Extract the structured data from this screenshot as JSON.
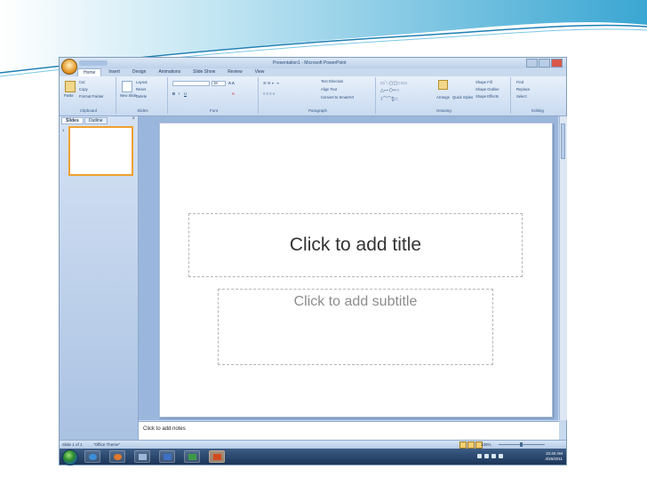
{
  "window": {
    "title": "Presentation1 - Microsoft PowerPoint"
  },
  "ribbon_tabs": [
    "Home",
    "Insert",
    "Design",
    "Animations",
    "Slide Show",
    "Review",
    "View"
  ],
  "ribbon": {
    "clipboard": {
      "label": "Clipboard",
      "paste": "Paste",
      "cut": "Cut",
      "copy": "Copy",
      "format_painter": "Format Painter"
    },
    "slides": {
      "label": "Slides",
      "new_slide": "New Slide",
      "layout": "Layout",
      "reset": "Reset",
      "delete": "Delete"
    },
    "font": {
      "label": "Font",
      "size": "18"
    },
    "paragraph": {
      "label": "Paragraph",
      "text_direction": "Text Direction",
      "align_text": "Align Text",
      "smartart": "Convert to SmartArt"
    },
    "drawing": {
      "label": "Drawing",
      "arrange": "Arrange",
      "quick_styles": "Quick Styles",
      "shape_fill": "Shape Fill",
      "shape_outline": "Shape Outline",
      "shape_effects": "Shape Effects"
    },
    "editing": {
      "label": "Editing",
      "find": "Find",
      "replace": "Replace",
      "select": "Select"
    }
  },
  "panel": {
    "tabs": [
      "Slides",
      "Outline"
    ],
    "thumb_number": "1"
  },
  "slide": {
    "title_placeholder": "Click to add title",
    "subtitle_placeholder": "Click to add subtitle"
  },
  "notes": {
    "placeholder": "Click to add notes"
  },
  "status": {
    "slide": "Slide 1 of 1",
    "theme": "\"Office Theme\"",
    "zoom": "100%"
  },
  "taskbar": {
    "time": "10:40 AM",
    "date": "4/26/2011"
  },
  "colors": {
    "accent": "#f0a030",
    "ribbon": "#c8daf0",
    "taskbar": "#1b3557"
  }
}
